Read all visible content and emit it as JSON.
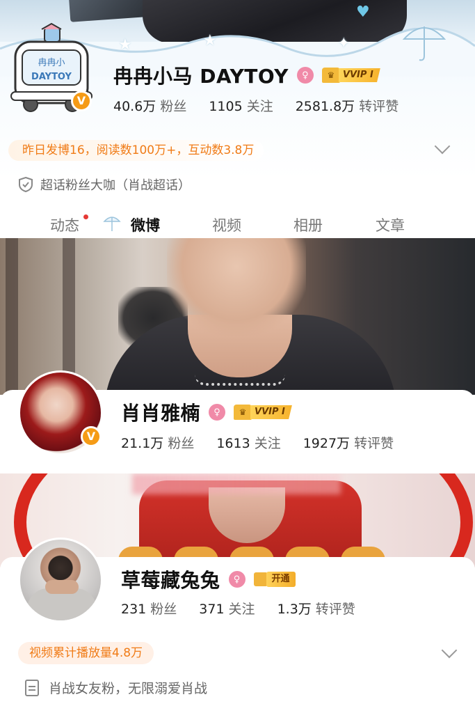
{
  "profiles": [
    {
      "name": "冉冉小马 DAYTOY",
      "badge_label": "VVIP I",
      "stats": [
        {
          "num": "40.6万",
          "label": "粉丝"
        },
        {
          "num": "1105",
          "label": "关注"
        },
        {
          "num": "2581.8万",
          "label": "转评赞"
        }
      ],
      "notice": "昨日发博16，阅读数100万+，互动数3.8万",
      "description": "超话粉丝大咖（肖战超话）",
      "avatar_text": "冉冉小",
      "avatar_text2": "DAYTOY",
      "verified_mark": "V"
    },
    {
      "name": "肖肖雅楠",
      "badge_label": "VVIP I",
      "stats": [
        {
          "num": "21.1万",
          "label": "粉丝"
        },
        {
          "num": "1613",
          "label": "关注"
        },
        {
          "num": "1927万",
          "label": "转评赞"
        }
      ],
      "verified_mark": "V"
    },
    {
      "name": "草莓藏兔兔",
      "badge_label": "开通",
      "stats": [
        {
          "num": "231",
          "label": "粉丝"
        },
        {
          "num": "371",
          "label": "关注"
        },
        {
          "num": "1.3万",
          "label": "转评赞"
        }
      ],
      "notice": "视频累计播放量4.8万",
      "description": "肖战女友粉，无限溺爱肖战"
    }
  ],
  "tabs": [
    "动态",
    "微博",
    "视频",
    "相册",
    "文章"
  ],
  "active_tab": "微博",
  "colors": {
    "accent_orange": "#f07b16",
    "gender_pink": "#f08aa8",
    "vip_gold": "#f6b22c",
    "verified_orange": "#f59b16",
    "notification_red": "#e53935"
  },
  "icons": {
    "gender": "female-gender-icon",
    "verified": "verified-v-icon",
    "expand": "chevron-down-icon",
    "super_topic": "shield-icon",
    "description": "document-icon"
  }
}
